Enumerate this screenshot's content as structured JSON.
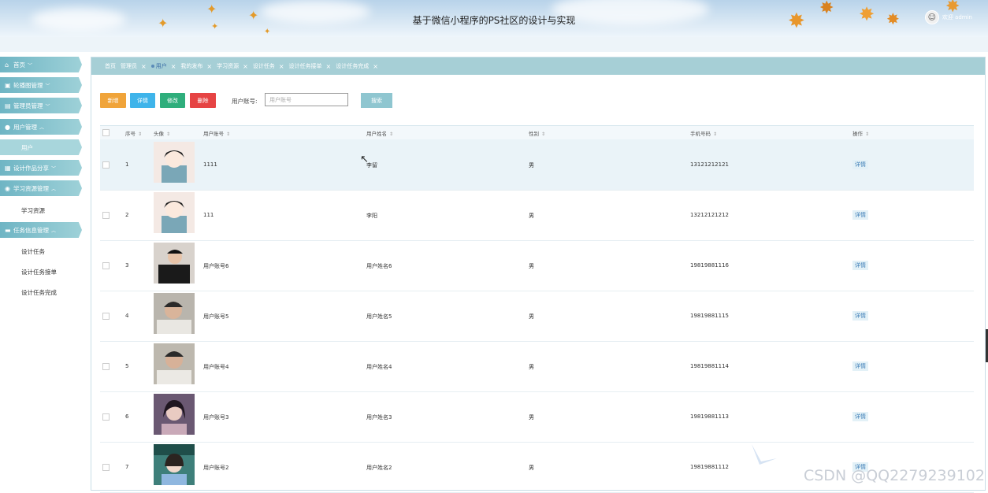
{
  "header": {
    "title": "基于微信小程序的PS社区的设计与实现",
    "welcome": "欢迎 admin"
  },
  "sidebar": {
    "items": [
      {
        "label": "首页",
        "icon": "home-icon"
      },
      {
        "label": "轮播图管理",
        "icon": "image-icon"
      },
      {
        "label": "管理员管理",
        "icon": "admin-icon"
      },
      {
        "label": "用户管理",
        "icon": "user-icon"
      },
      {
        "label": "设计作品分享",
        "icon": "grid-icon"
      },
      {
        "label": "学习资源管理",
        "icon": "book-icon"
      },
      {
        "label": "任务信息管理",
        "icon": "briefcase-icon"
      }
    ],
    "sub_user": "用户",
    "sub_resource": "学习资源",
    "sub_tasks": [
      "设计任务",
      "设计任务接单",
      "设计任务完成"
    ]
  },
  "tabs": [
    "首页",
    "管理员",
    "用户",
    "我的发布",
    "学习资源",
    "设计任务",
    "设计任务接单",
    "设计任务完成"
  ],
  "toolbar": {
    "add": "新增",
    "detail": "详情",
    "edit": "修改",
    "delete": "删除",
    "account_label": "用户账号:",
    "account_placeholder": "用户账号",
    "search": "搜索"
  },
  "table": {
    "headers": [
      "序号",
      "头像",
      "用户账号",
      "用户姓名",
      "性别",
      "手机号码",
      "操作"
    ],
    "rows": [
      {
        "no": "1",
        "account": "1111",
        "name": "李留",
        "gender": "男",
        "phone": "13121212121",
        "op": "详情"
      },
      {
        "no": "2",
        "account": "111",
        "name": "李阳",
        "gender": "男",
        "phone": "13212121212",
        "op": "详情"
      },
      {
        "no": "3",
        "account": "用户账号6",
        "name": "用户姓名6",
        "gender": "男",
        "phone": "19819881116",
        "op": "详情"
      },
      {
        "no": "4",
        "account": "用户账号5",
        "name": "用户姓名5",
        "gender": "男",
        "phone": "19819881115",
        "op": "详情"
      },
      {
        "no": "5",
        "account": "用户账号4",
        "name": "用户姓名4",
        "gender": "男",
        "phone": "19819881114",
        "op": "详情"
      },
      {
        "no": "6",
        "account": "用户账号3",
        "name": "用户姓名3",
        "gender": "男",
        "phone": "19819881113",
        "op": "详情"
      },
      {
        "no": "7",
        "account": "用户账号2",
        "name": "用户姓名2",
        "gender": "男",
        "phone": "19819881112",
        "op": "详情"
      }
    ]
  },
  "watermark": "CSDN @QQ2279239102",
  "colors": {
    "accent": "#8fc6d0",
    "add": "#f0a43a",
    "detail": "#3fb4ea",
    "edit": "#2fae7c",
    "delete": "#e64444"
  }
}
